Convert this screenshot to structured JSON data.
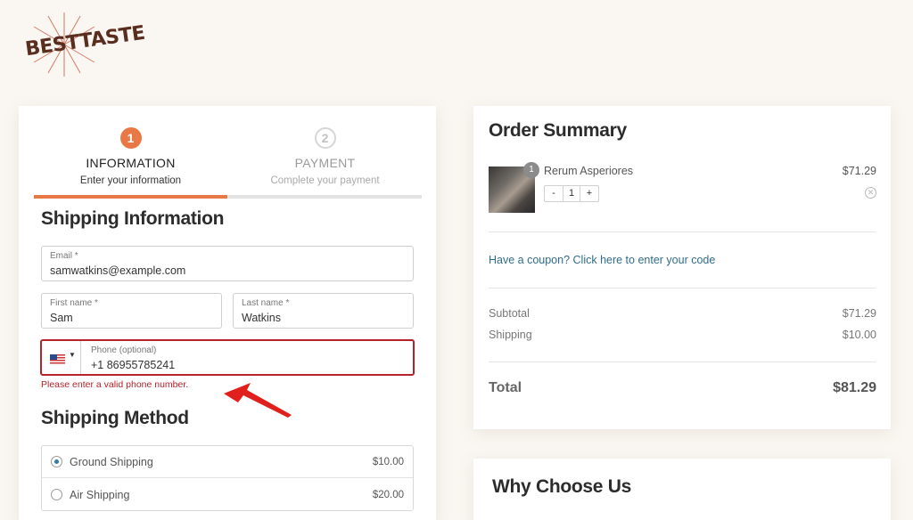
{
  "brand": {
    "logo_text": "BESTTASTE"
  },
  "steps": [
    {
      "number": "1",
      "title": "INFORMATION",
      "subtitle": "Enter your information"
    },
    {
      "number": "2",
      "title": "PAYMENT",
      "subtitle": "Complete your payment"
    }
  ],
  "shipping_info": {
    "heading": "Shipping Information",
    "email": {
      "label": "Email *",
      "value": "samwatkins@example.com"
    },
    "first_name": {
      "label": "First name *",
      "value": "Sam"
    },
    "last_name": {
      "label": "Last name *",
      "value": "Watkins"
    },
    "phone": {
      "label": "Phone (optional)",
      "value": "+1 86955785241",
      "country_flag_icon": "us-flag-icon"
    },
    "phone_error": "Please enter a valid phone number."
  },
  "shipping_method": {
    "heading": "Shipping Method",
    "options": [
      {
        "name": "Ground Shipping",
        "price": "$10.00",
        "selected": true
      },
      {
        "name": "Air Shipping",
        "price": "$20.00",
        "selected": false
      }
    ]
  },
  "order_summary": {
    "heading": "Order Summary",
    "item": {
      "name": "Rerum Asperiores",
      "price": "$71.29",
      "quantity": "1",
      "minus": "-",
      "plus": "+"
    },
    "coupon_text": "Have a coupon? Click here to enter your code",
    "subtotal": {
      "label": "Subtotal",
      "value": "$71.29"
    },
    "shipping": {
      "label": "Shipping",
      "value": "$10.00"
    },
    "total": {
      "label": "Total",
      "value": "$81.29"
    }
  },
  "why_choose_us": {
    "heading": "Why Choose Us"
  },
  "colors": {
    "accent": "#e87845",
    "error": "#b4222a",
    "link": "#2f6d8a",
    "background": "#faf7f2"
  }
}
